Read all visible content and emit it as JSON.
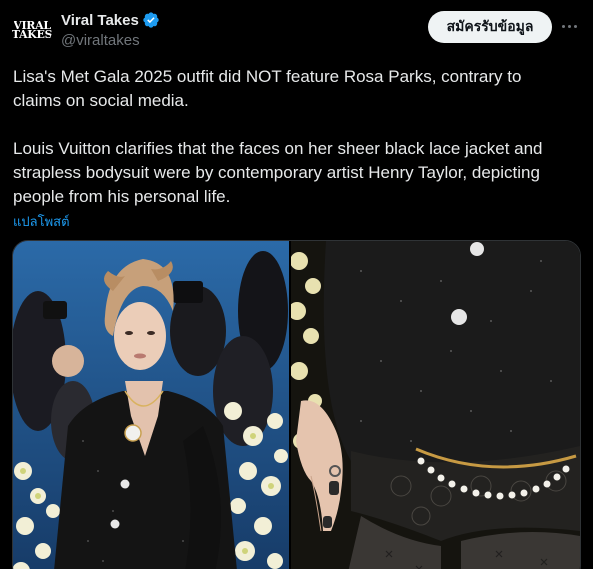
{
  "author": {
    "avatar_line1": "VIRAL",
    "avatar_line2": "TAKES",
    "display_name": "Viral Takes",
    "handle": "@viraltakes",
    "verified_icon": "verified-badge-icon"
  },
  "actions": {
    "follow_label": "สมัครรับข้อมูล",
    "more_icon": "more-horizontal-icon"
  },
  "tweet": {
    "paragraph1": "Lisa's Met Gala 2025 outfit did NOT feature Rosa Parks, contrary to claims on social media.",
    "paragraph2": "Louis Vuitton clarifies that the faces on her sheer black lace jacket and strapless bodysuit were by contemporary artist Henry Taylor, depicting people from his personal life.",
    "translate_label": "แปลโพสต์"
  },
  "media": {
    "photos": [
      "red-carpet-photo",
      "outfit-closeup-photo"
    ]
  },
  "colors": {
    "background": "#000000",
    "text": "#e7e9ea",
    "secondary": "#71767b",
    "link": "#1d9bf0",
    "verified": "#1d9bf0",
    "follow_bg": "#eff3f4"
  }
}
